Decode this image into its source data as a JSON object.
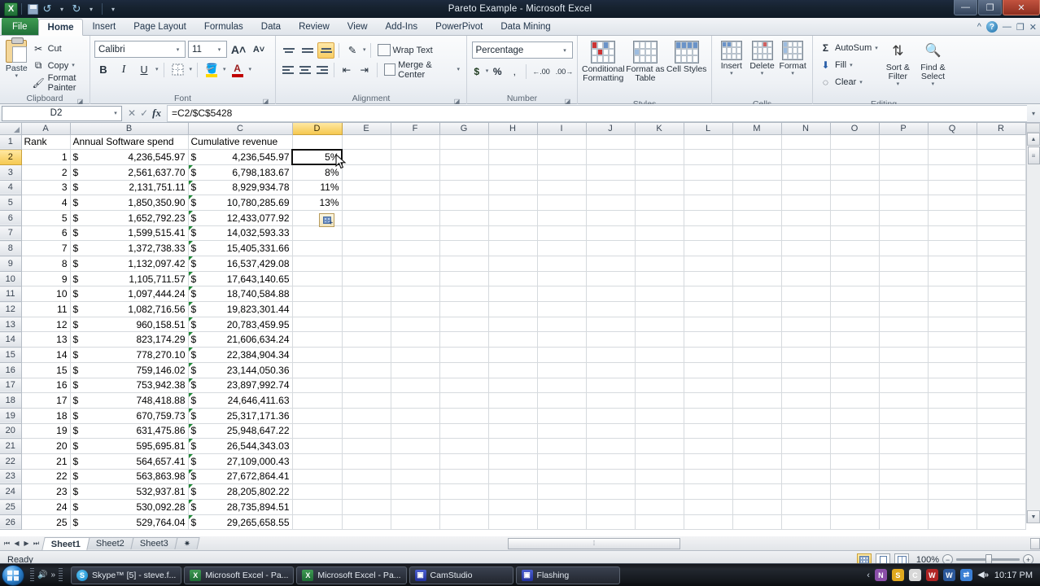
{
  "window": {
    "title": "Pareto Example  -  Microsoft Excel",
    "minimize": "—",
    "restore": "❐",
    "close": "✕"
  },
  "quick_access": {
    "logo": "X",
    "save": "save-icon",
    "undo": "undo-icon",
    "redo": "redo-icon",
    "customize": "customize-icon"
  },
  "ribbon": {
    "file_tab": "File",
    "tabs": [
      "Home",
      "Insert",
      "Page Layout",
      "Formulas",
      "Data",
      "Review",
      "View",
      "Add-Ins",
      "PowerPivot",
      "Data Mining"
    ],
    "active_tab": "Home",
    "minimize_ribbon": "^",
    "help": "?",
    "win_minimize": "—",
    "win_restore": "❐",
    "win_close": "✕",
    "groups": {
      "clipboard": {
        "label": "Clipboard",
        "paste": "Paste",
        "cut": "Cut",
        "copy": "Copy",
        "format_painter": "Format Painter"
      },
      "font": {
        "label": "Font",
        "font_name": "Calibri",
        "font_size": "11",
        "grow_font": "A",
        "shrink_font": "A",
        "bold": "B",
        "italic": "I",
        "underline": "U",
        "borders": "borders-icon",
        "fill_color": "fill-color-icon",
        "font_color": "A"
      },
      "alignment": {
        "label": "Alignment",
        "top_align": "top-align-icon",
        "middle_align": "middle-align-icon",
        "bottom_align": "bottom-align-icon",
        "orientation": "orientation-icon",
        "align_left": "align-left-icon",
        "align_center": "align-center-icon",
        "align_right": "align-right-icon",
        "decrease_indent": "decrease-indent-icon",
        "increase_indent": "increase-indent-icon",
        "wrap_text": "Wrap Text",
        "merge_center": "Merge & Center"
      },
      "number": {
        "label": "Number",
        "format": "Percentage",
        "accounting": "$",
        "percent_style": "%",
        "comma_style": ",",
        "increase_decimal": "increase-decimal-icon",
        "decrease_decimal": "decrease-decimal-icon"
      },
      "styles": {
        "label": "Styles",
        "conditional_formatting": "Conditional Formatting",
        "format_as_table": "Format as Table",
        "cell_styles": "Cell Styles"
      },
      "cells": {
        "label": "Cells",
        "insert": "Insert",
        "delete": "Delete",
        "format": "Format"
      },
      "editing": {
        "label": "Editing",
        "autosum": "AutoSum",
        "fill": "Fill",
        "clear": "Clear",
        "sort_filter": "Sort & Filter",
        "find_select": "Find & Select"
      }
    }
  },
  "formula_bar": {
    "name_box": "D2",
    "cancel": "✕",
    "enter": "✓",
    "insert_function": "fx",
    "formula": "=C2/$C$5428",
    "expand": "▾"
  },
  "grid": {
    "columns": [
      "A",
      "B",
      "C",
      "D",
      "E",
      "F",
      "G",
      "H",
      "I",
      "J",
      "K",
      "L",
      "M",
      "N",
      "O",
      "P",
      "Q",
      "R"
    ],
    "selected_column": "D",
    "selected_row": "2",
    "selected_cell": "D2",
    "headers": {
      "a": "Rank",
      "b": "Annual Software spend",
      "c": "Cumulative revenue"
    },
    "currency_symbol": "$",
    "rows": [
      {
        "n": "1",
        "rank": "Rank",
        "spend": "Annual Software spend",
        "cum": "Cumulative revenue",
        "pct": "",
        "is_header": true
      },
      {
        "n": "2",
        "rank": "1",
        "spend": "4,236,545.97",
        "cum": "4,236,545.97",
        "pct": "5%"
      },
      {
        "n": "3",
        "rank": "2",
        "spend": "2,561,637.70",
        "cum": "6,798,183.67",
        "pct": "8%"
      },
      {
        "n": "4",
        "rank": "3",
        "spend": "2,131,751.11",
        "cum": "8,929,934.78",
        "pct": "11%"
      },
      {
        "n": "5",
        "rank": "4",
        "spend": "1,850,350.90",
        "cum": "10,780,285.69",
        "pct": "13%"
      },
      {
        "n": "6",
        "rank": "5",
        "spend": "1,652,792.23",
        "cum": "12,433,077.92",
        "pct": ""
      },
      {
        "n": "7",
        "rank": "6",
        "spend": "1,599,515.41",
        "cum": "14,032,593.33",
        "pct": ""
      },
      {
        "n": "8",
        "rank": "7",
        "spend": "1,372,738.33",
        "cum": "15,405,331.66",
        "pct": ""
      },
      {
        "n": "9",
        "rank": "8",
        "spend": "1,132,097.42",
        "cum": "16,537,429.08",
        "pct": ""
      },
      {
        "n": "10",
        "rank": "9",
        "spend": "1,105,711.57",
        "cum": "17,643,140.65",
        "pct": ""
      },
      {
        "n": "11",
        "rank": "10",
        "spend": "1,097,444.24",
        "cum": "18,740,584.88",
        "pct": ""
      },
      {
        "n": "12",
        "rank": "11",
        "spend": "1,082,716.56",
        "cum": "19,823,301.44",
        "pct": ""
      },
      {
        "n": "13",
        "rank": "12",
        "spend": "960,158.51",
        "cum": "20,783,459.95",
        "pct": ""
      },
      {
        "n": "14",
        "rank": "13",
        "spend": "823,174.29",
        "cum": "21,606,634.24",
        "pct": ""
      },
      {
        "n": "15",
        "rank": "14",
        "spend": "778,270.10",
        "cum": "22,384,904.34",
        "pct": ""
      },
      {
        "n": "16",
        "rank": "15",
        "spend": "759,146.02",
        "cum": "23,144,050.36",
        "pct": ""
      },
      {
        "n": "17",
        "rank": "16",
        "spend": "753,942.38",
        "cum": "23,897,992.74",
        "pct": ""
      },
      {
        "n": "18",
        "rank": "17",
        "spend": "748,418.88",
        "cum": "24,646,411.63",
        "pct": ""
      },
      {
        "n": "19",
        "rank": "18",
        "spend": "670,759.73",
        "cum": "25,317,171.36",
        "pct": ""
      },
      {
        "n": "20",
        "rank": "19",
        "spend": "631,475.86",
        "cum": "25,948,647.22",
        "pct": ""
      },
      {
        "n": "21",
        "rank": "20",
        "spend": "595,695.81",
        "cum": "26,544,343.03",
        "pct": ""
      },
      {
        "n": "22",
        "rank": "21",
        "spend": "564,657.41",
        "cum": "27,109,000.43",
        "pct": ""
      },
      {
        "n": "23",
        "rank": "22",
        "spend": "563,863.98",
        "cum": "27,672,864.41",
        "pct": ""
      },
      {
        "n": "24",
        "rank": "23",
        "spend": "532,937.81",
        "cum": "28,205,802.22",
        "pct": ""
      },
      {
        "n": "25",
        "rank": "24",
        "spend": "530,092.28",
        "cum": "28,735,894.51",
        "pct": ""
      },
      {
        "n": "26",
        "rank": "25",
        "spend": "529,764.04",
        "cum": "29,265,658.55",
        "pct": ""
      }
    ],
    "autofill_tag": "autofill-options-icon"
  },
  "sheet_tabs": {
    "first": "⏮",
    "prev": "◀",
    "next": "▶",
    "last": "⏭",
    "tabs": [
      "Sheet1",
      "Sheet2",
      "Sheet3"
    ],
    "active": "Sheet1",
    "insert_sheet": "insert-worksheet-icon"
  },
  "status_bar": {
    "mode": "Ready",
    "view_normal": "normal-view-icon",
    "view_page_layout": "page-layout-view-icon",
    "view_page_break": "page-break-view-icon",
    "zoom": "100%",
    "zoom_out": "−",
    "zoom_in": "+"
  },
  "taskbar": {
    "start": "start-orb-icon",
    "quick_launch_chevron": "»",
    "items": [
      {
        "label": "Skype™ [5] - steve.f...",
        "icon": "skype-icon"
      },
      {
        "label": "Microsoft Excel - Pa...",
        "icon": "excel-icon"
      },
      {
        "label": "Microsoft Excel - Pa...",
        "icon": "excel-icon"
      },
      {
        "label": "CamStudio",
        "icon": "camstudio-icon"
      },
      {
        "label": "Flashing",
        "icon": "camstudio-icon"
      }
    ],
    "tray_expand": "‹",
    "tray": [
      {
        "name": "onenote-tray-icon",
        "glyph": "N",
        "color": "#8b4fa8"
      },
      {
        "name": "skype-tray-icon",
        "glyph": "S",
        "color": "#e0a81e"
      },
      {
        "name": "chrome-tray-icon",
        "glyph": "C",
        "color": "#d8d8d8"
      },
      {
        "name": "antivirus-tray-icon",
        "glyph": "W",
        "color": "#b02424"
      },
      {
        "name": "word-tray-icon",
        "glyph": "W",
        "color": "#2b579a"
      },
      {
        "name": "network-tray-icon",
        "glyph": "⇄",
        "color": "#3b7fd4"
      },
      {
        "name": "volume-tray-icon",
        "glyph": "◀»",
        "color": "transparent"
      }
    ],
    "clock": "10:17 PM"
  }
}
